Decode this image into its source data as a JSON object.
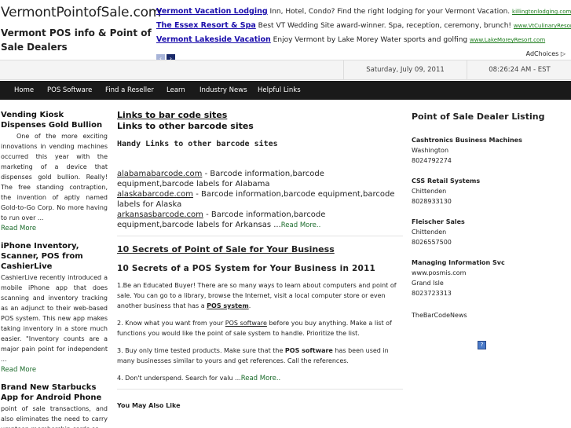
{
  "site": {
    "title": "VermontPointofSale.com",
    "tagline": "Vermont POS info & Point of Sale Dealers"
  },
  "ads": [
    {
      "title": "Vermont Vacation Lodging",
      "text": " Inn, Hotel, Condo? Find the right lodging for your Vermont Vacation. ",
      "url": "killingtonlodging.com"
    },
    {
      "title": "The Essex Resort & Spa",
      "text": " Best VT Wedding Site award-winner. Spa, reception, ceremony, brunch! ",
      "url": "www.VtCulinaryResort.com"
    },
    {
      "title": "Vermont Lakeside Vacation",
      "text": " Enjoy Vermont by Lake Morey Water sports and golfing ",
      "url": "www.LakeMoreyResort.com"
    }
  ],
  "ad_nav": {
    "prev": "‹",
    "next": "›",
    "adchoices": "AdChoices ▷"
  },
  "datebar": {
    "date": "Saturday, July 09, 2011",
    "time": "08:26:24 AM - EST"
  },
  "nav": [
    "Home",
    "POS Software",
    "Find a Reseller",
    "Learn",
    "Industry News",
    "Helpful Links"
  ],
  "left_posts": [
    {
      "title": "Vending Kiosk Dispenses Gold Bullion",
      "body": "One of the more exciting innovations in vending machines occurred this year with the marketing of a device that dispenses gold bullion. Really! The free standing contraption, the invention of aptly named Gold-to-Go Corp. No more having to run over ...",
      "more": "Read More"
    },
    {
      "title": "iPhone Inventory, Scanner, POS from CashierLive",
      "body": "CashierLive recently introduced a mobile iPhone app that does scanning and inventory tracking as an adjunct to their web-based POS system. This new app makes taking inventory in a store much easier. \"Inventory counts are a major pain point for independent ...",
      "more": "Read More"
    },
    {
      "title": "Brand New Starbucks App for Android Phone",
      "body": "point of sale transactions, and also eliminates the need to carry umpteen membership cards or ...",
      "more": ""
    }
  ],
  "middle": {
    "heading1": "Links to bar code sites",
    "heading2": "Links to other barcode sites",
    "handy": "Handy Links to other barcode sites",
    "links": [
      {
        "site": "alabamabarcode.com",
        "desc": " - Barcode information,barcode equipment,barcode labels for Alabama"
      },
      {
        "site": "alaskabarcode.com",
        "desc": " - Barcode information,barcode equipment,barcode labels for Alaska"
      },
      {
        "site": "arkansasbarcode.com",
        "desc": " - Barcode information,barcode equipment,barcode labels for Arkansas ..."
      }
    ],
    "links_more": "Read More..",
    "secrets_link": "10 Secrets of Point of Sale for Your Business",
    "secrets_heading": "10 Secrets of a POS System for Your Business in 2011",
    "p1a": "1.Be an Educated Buyer! There are so many ways to learn about computers and point of sale. You can go to a library, browse the Internet, visit a local computer store or even another business that has a ",
    "p1_bold": "POS system",
    "p1b": ".",
    "p2a": "2. Know what you want from your ",
    "p2_link": "POS software",
    "p2b": " before you buy anything. Make a list of functions you would like the point of sale system to handle. Prioritize the list.",
    "p3a": "3. Buy only time tested products. Make sure that the ",
    "p3_bold": "POS software",
    "p3b": " has been used in many businesses similar to yours and get references. Call the references.",
    "p4": "4. Don't underspend. Search for valu ...",
    "p4_more": "Read More..",
    "also": "You May Also Like"
  },
  "right": {
    "title": "Point of Sale Dealer Listing",
    "dealers": [
      {
        "name": "Cashtronics Business Machines",
        "city": "Washington",
        "phone": "8024792274"
      },
      {
        "name": "CSS Retail Systems",
        "city": "Chittenden",
        "phone": "8028933130"
      },
      {
        "name": "Fleischer Sales",
        "city": "Chittenden",
        "phone": "8026557500"
      },
      {
        "name": "Managing Information Svc",
        "city": "www.posmis.com",
        "phone": "Grand Isle",
        "extra": "8023723313"
      }
    ],
    "news": "TheBarCodeNews",
    "icon_glyph": "?"
  }
}
